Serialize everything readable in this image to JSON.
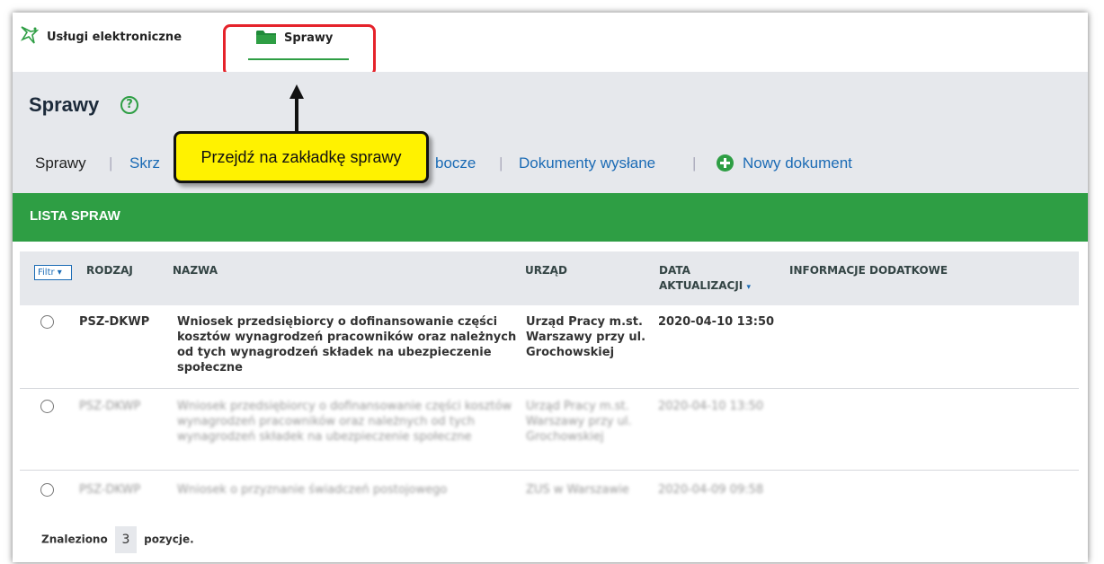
{
  "topbar": {
    "brand": "Usługi elektroniczne",
    "tab_label": "Sprawy"
  },
  "header": {
    "title": "Sprawy",
    "help_glyph": "?"
  },
  "nav": {
    "current": "Sprawy",
    "sep": "|",
    "link1_visible": "Skrz",
    "link2_visible": "bocze",
    "link3": "Dokumenty wysłane",
    "new_document": "Nowy dokument"
  },
  "tooltip": {
    "text": "Przejdź na zakładkę sprawy"
  },
  "list": {
    "heading": "LISTA SPRAW",
    "filter_label": "Filtr ▾",
    "columns": {
      "rodzaj": "RODZAJ",
      "nazwa": "NAZWA",
      "urzad": "URZĄD",
      "data_line1": "DATA",
      "data_line2": "AKTUALIZACJI",
      "sort_glyph": "▾",
      "info": "INFORMACJE DODATKOWE"
    },
    "rows": [
      {
        "rodzaj": "PSZ-DKWP",
        "nazwa": "Wniosek przedsiębiorcy o dofinansowanie części kosztów wynagrodzeń pracowników oraz należnych od tych wynagrodzeń składek na ubezpieczenie społeczne",
        "urzad": "Urząd Pracy m.st. Warszawy przy ul. Grochowskiej",
        "data": "2020-04-10 13:50"
      },
      {
        "rodzaj": "PSZ-DKWP",
        "nazwa": "Wniosek przedsiębiorcy o dofinansowanie części kosztów wynagrodzeń pracowników oraz należnych od tych wynagrodzeń składek na ubezpieczenie społeczne",
        "urzad": "Urząd Pracy m.st. Warszawy przy ul. Grochowskiej",
        "data": "2020-04-10 13:50"
      },
      {
        "rodzaj": "PSZ-DKWP",
        "nazwa": "Wniosek o przyznanie świadczeń postojowego",
        "urzad": "ZUS w Warszawie",
        "data": "2020-04-09 09:58"
      }
    ]
  },
  "footer": {
    "prefix": "Znaleziono",
    "count": "3",
    "suffix": "pozycje."
  },
  "colors": {
    "green": "#2e9e44",
    "link_blue": "#1b6bb5",
    "callout_red": "#e5232b",
    "tooltip_yellow": "#fff200",
    "header_gray": "#e6e8ec"
  },
  "icons": [
    "app-logo-icon",
    "folder-icon",
    "help-icon",
    "plus-circle-icon",
    "arrow-up-icon",
    "radio-icon"
  ]
}
